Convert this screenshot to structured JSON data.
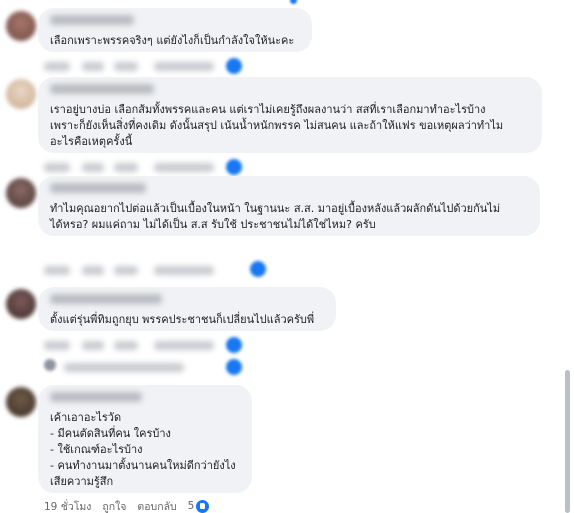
{
  "comments": [
    {
      "text": "เลือกเพราะพรรคจริงๆ แต่ยังไงก็เป็นกำลังใจให้นะคะ"
    },
    {
      "text": "เราอยู่บางบ่อ เลือกส้มทั้งพรรคและคน แต่เราไม่เคยรู้ถึงผลงานว่า สสที่เราเลือกมาทำอะไรบ้าง\nเพราะก็ยังเห็นสิ่งที่คงเดิม ดังนั้นสรุป เน้นน้ำหนักพรรค ไม่สนคน และถ้าให้แฟร ขอเหตุผลว่าทำไม\nอะไรคือเหตุครั้งนี้"
    },
    {
      "text": "ทำไมคุณอยากไปต่อแล้วเป็นเบื้องในหน้า ในฐานนะ ส.ส. มาอยู่เบื้องหลังแล้วผลักดันไปด้วยกันไม่\nได้หรอ? ผมแค่ถาม ไม่ได้เป็น ส.ส รับใช้ ประชาชนไม่ได้ใช่ไหม? ครับ"
    },
    {
      "text": "ตั้งแต่รุ่นพี่ทิมถูกยุบ พรรคประชาชนก็เปลี่ยนไปแล้วครับพี่"
    },
    {
      "text": "เค้าเอาอะไรวัด\n- มีคนตัดสินที่คน ใครบ้าง\n- ใช้เกณฑ์อะไรบ้าง\n- คนทำงานมาตั้งนานคนใหม่ดีกว่ายังไง\nเสียความรู้สึก"
    }
  ],
  "last_actions": {
    "time": "19 ชั่วโมง",
    "like": "ถูกใจ",
    "reply": "ตอบกลับ",
    "reaction_count": "5"
  },
  "colors": {
    "bubble": "#f0f2f5",
    "like_blue": "#1877f2",
    "meta_text": "#65676b"
  }
}
